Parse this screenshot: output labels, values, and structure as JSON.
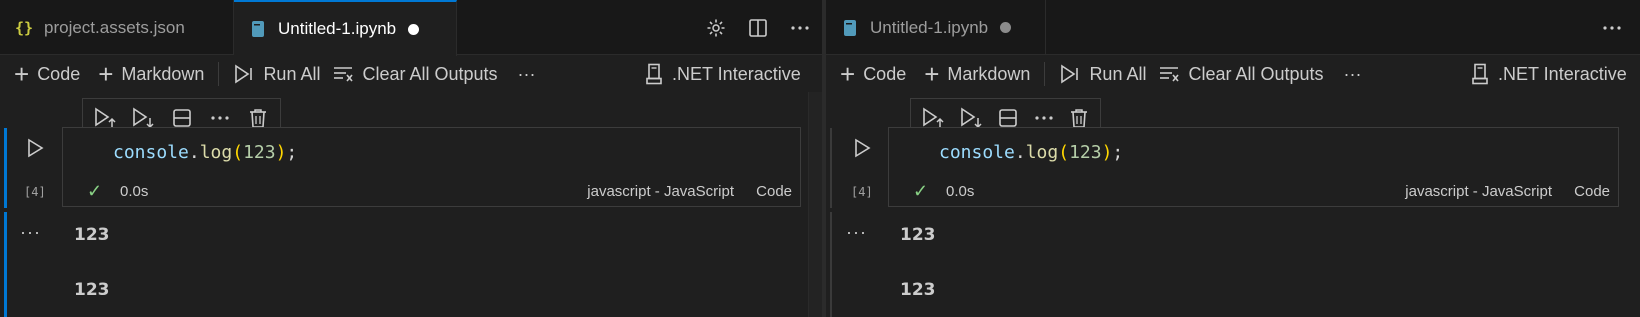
{
  "left_group": {
    "tabs": [
      {
        "label": "project.assets.json",
        "icon": "json-braces-icon",
        "icon_text": "{}"
      },
      {
        "label": "Untitled-1.ipynb",
        "icon": "notebook-icon",
        "dirty": true
      }
    ],
    "toolbar": {
      "code": "Code",
      "markdown": "Markdown",
      "run_all": "Run All",
      "clear_outputs": "Clear All Outputs",
      "more": "···",
      "kernel": ".NET Interactive"
    },
    "cell": {
      "exec_count": "[4]",
      "code": {
        "obj": "console",
        "dot": ".",
        "fn": "log",
        "lparen": "(",
        "num": "123",
        "rparen": ")",
        "semi": ";"
      },
      "duration": "0.0s",
      "language": "javascript - JavaScript",
      "cell_type": "Code",
      "outputs": [
        "123",
        "123"
      ],
      "more": "···"
    }
  },
  "right_group": {
    "tabs": [
      {
        "label": "Untitled-1.ipynb",
        "icon": "notebook-icon",
        "dirty": true
      }
    ],
    "toolbar": {
      "code": "Code",
      "markdown": "Markdown",
      "run_all": "Run All",
      "clear_outputs": "Clear All Outputs",
      "more": "···",
      "kernel": ".NET Interactive"
    },
    "cell": {
      "exec_count": "[4]",
      "code": {
        "obj": "console",
        "dot": ".",
        "fn": "log",
        "lparen": "(",
        "num": "123",
        "rparen": ")",
        "semi": ";"
      },
      "duration": "0.0s",
      "language": "javascript - JavaScript",
      "cell_type": "Code",
      "outputs": [
        "123",
        "123"
      ],
      "more": "···"
    }
  },
  "colors": {
    "accent": "#0078d4",
    "background": "#1f1f1f",
    "success": "#89d185"
  }
}
